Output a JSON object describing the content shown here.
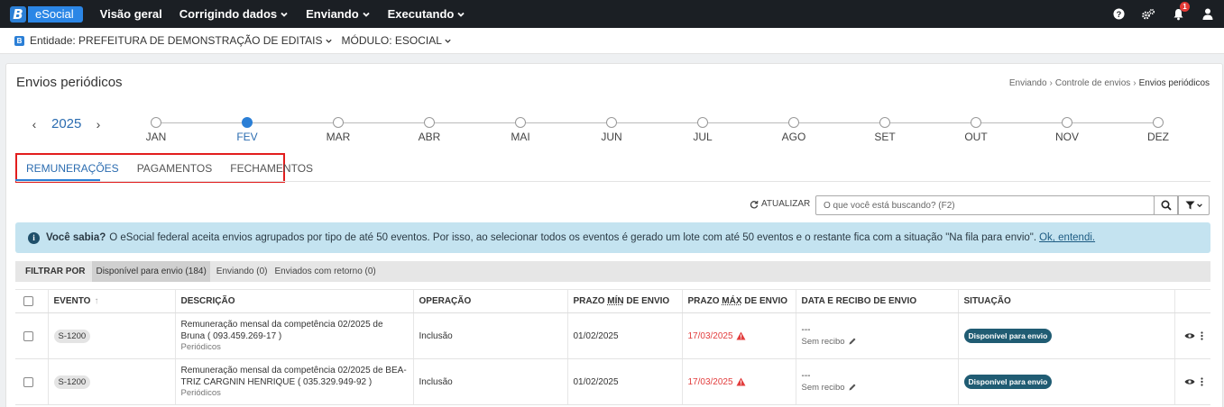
{
  "topnav": {
    "logo_letter": "B",
    "app_name": "eSocial",
    "items": [
      "Visão geral",
      "Corrigindo dados",
      "Enviando",
      "Executando"
    ],
    "notifications_count": "1"
  },
  "entity_bar": {
    "icon_letter": "B",
    "entity": "Entidade: PREFEITURA DE DEMONSTRAÇÃO DE EDITAIS",
    "module": "MÓDULO: ESOCIAL"
  },
  "page": {
    "title": "Envios periódicos",
    "breadcrumb": [
      "Enviando",
      "Controle de envios",
      "Envios periódicos"
    ]
  },
  "timeline": {
    "year": "2025",
    "months": [
      "JAN",
      "FEV",
      "MAR",
      "ABR",
      "MAI",
      "JUN",
      "JUL",
      "AGO",
      "SET",
      "OUT",
      "NOV",
      "DEZ"
    ],
    "active_month": "FEV"
  },
  "tabs": [
    "REMUNERAÇÕES",
    "PAGAMENTOS",
    "FECHAMENTOS"
  ],
  "active_tab": "REMUNERAÇÕES",
  "toolbar": {
    "refresh_label": "ATUALIZAR",
    "search_placeholder": "O que você está buscando? (F2)"
  },
  "info_banner": {
    "title": "Você sabia?",
    "text": "O eSocial federal aceita envios agrupados por tipo de até 50 eventos. Por isso, ao selecionar todos os eventos é gerado um lote com até 50 eventos e o restante fica com a situação \"Na fila para envio\".",
    "link": "Ok, entendi."
  },
  "filter": {
    "label": "FILTRAR POR",
    "chips": [
      "Disponível para envio (184)",
      "Enviando (0)",
      "Enviados com retorno (0)"
    ],
    "active": "Disponível para envio (184)"
  },
  "table": {
    "headers": {
      "evento": "EVENTO",
      "descricao": "DESCRIÇÃO",
      "operacao": "OPERAÇÃO",
      "prazo_min_pre": "PRAZO ",
      "prazo_min_u": "MÍN",
      "prazo_min_post": " DE ENVIO",
      "prazo_max_pre": "PRAZO ",
      "prazo_max_u": "MÁX",
      "prazo_max_post": " DE ENVIO",
      "data_recibo": "DATA E RECIBO DE ENVIO",
      "situacao": "SITUAÇÃO"
    },
    "rows": [
      {
        "evento": "S-1200",
        "descricao_l1": "Remuneração mensal da competência 02/2025 de",
        "descricao_l2": "Bruna ( 093.459.269-17 )",
        "descricao_sub": "Periódicos",
        "operacao": "Inclusão",
        "prazo_min": "01/02/2025",
        "prazo_max": "17/03/2025",
        "recibo_data": "---",
        "recibo": "Sem recibo",
        "situacao": "Disponível para envio"
      },
      {
        "evento": "S-1200",
        "descricao_l1": "Remuneração mensal da competência 02/2025 de BEA-",
        "descricao_l2": "TRIZ CARGNIN HENRIQUE ( 035.329.949-92 )",
        "descricao_sub": "Periódicos",
        "operacao": "Inclusão",
        "prazo_min": "01/02/2025",
        "prazo_max": "17/03/2025",
        "recibo_data": "---",
        "recibo": "Sem recibo",
        "situacao": "Disponível para envio"
      }
    ]
  },
  "colors": {
    "accent": "#2b7fd6",
    "deadline_red": "#e23d3d",
    "status_badge": "#205c73",
    "info_bg": "#c4e3f0",
    "highlight_box": "#e21d1d"
  }
}
